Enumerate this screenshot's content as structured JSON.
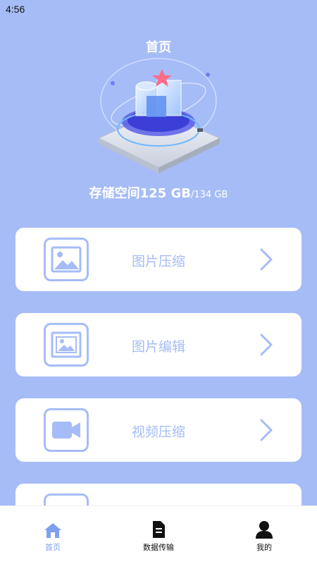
{
  "status_bar": {
    "time": "4:56"
  },
  "header": {
    "title": "首页"
  },
  "storage": {
    "label": "存储空间",
    "used": "125 GB",
    "separator": "/",
    "total": "134 GB"
  },
  "features": [
    {
      "label": "图片压缩",
      "icon": "image-icon"
    },
    {
      "label": "图片编辑",
      "icon": "image-frame-icon"
    },
    {
      "label": "视频压缩",
      "icon": "video-camera-icon"
    }
  ],
  "tabbar": {
    "items": [
      {
        "label": "首页",
        "icon": "home-icon",
        "active": true
      },
      {
        "label": "数据传输",
        "icon": "file-icon",
        "active": false
      },
      {
        "label": "我的",
        "icon": "person-icon",
        "active": false
      }
    ]
  },
  "colors": {
    "background": "#a6bcf7",
    "accent": "#7fa0ef",
    "card": "#ffffff"
  }
}
